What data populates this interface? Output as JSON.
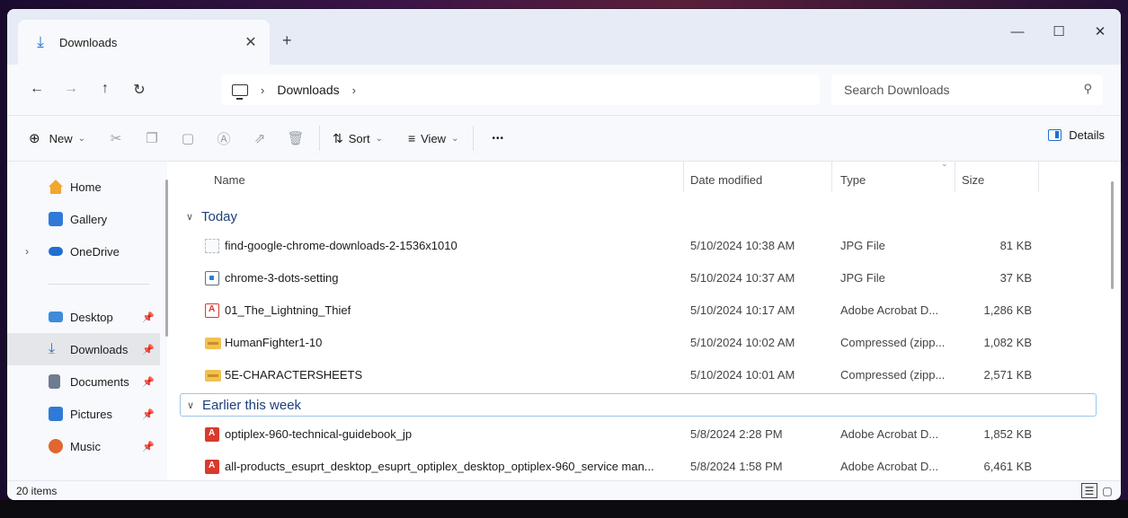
{
  "tab": {
    "title": "Downloads",
    "close": "✕",
    "new_tab": "+"
  },
  "window_controls": {
    "minimize": "—",
    "maximize": "☐",
    "close": "✕"
  },
  "nav": {
    "back": "←",
    "forward": "→",
    "up": "↑",
    "refresh": "↻"
  },
  "breadcrumb": {
    "sep1": "›",
    "current": "Downloads",
    "sep2": "›"
  },
  "search": {
    "placeholder": "Search Downloads",
    "icon": "search-icon"
  },
  "commands": {
    "new_label": "New",
    "sort_label": "Sort",
    "view_label": "View",
    "more": "•••",
    "details_label": "Details"
  },
  "sidebar": {
    "items": [
      {
        "label": "Home",
        "icon": "home-icon",
        "color": "#f0a830"
      },
      {
        "label": "Gallery",
        "icon": "gallery-icon",
        "color": "#2f7ad8"
      },
      {
        "label": "OneDrive",
        "icon": "cloud-icon",
        "color": "#1f6fd0"
      },
      {
        "label": "Desktop",
        "icon": "desktop-icon",
        "color": "#3d8bd9"
      },
      {
        "label": "Downloads",
        "icon": "download-icon",
        "color": "#1f6fd0"
      },
      {
        "label": "Documents",
        "icon": "documents-icon",
        "color": "#6f7c8f"
      },
      {
        "label": "Pictures",
        "icon": "pictures-icon",
        "color": "#2f7ad8"
      },
      {
        "label": "Music",
        "icon": "music-icon",
        "color": "#e0672f"
      }
    ]
  },
  "columns": {
    "name": "Name",
    "date": "Date modified",
    "type": "Type",
    "size": "Size"
  },
  "groups": {
    "today": "Today",
    "earlier": "Earlier this week"
  },
  "files": [
    {
      "name": "find-google-chrome-downloads-2-1536x1010",
      "date": "5/10/2024 10:38 AM",
      "type": "JPG File",
      "size": "81 KB",
      "icon": "image-placeholder-icon"
    },
    {
      "name": "chrome-3-dots-setting",
      "date": "5/10/2024 10:37 AM",
      "type": "JPG File",
      "size": "37 KB",
      "icon": "image-file-icon"
    },
    {
      "name": "01_The_Lightning_Thief",
      "date": "5/10/2024 10:17 AM",
      "type": "Adobe Acrobat D...",
      "size": "1,286 KB",
      "icon": "pdf-icon"
    },
    {
      "name": "HumanFighter1-10",
      "date": "5/10/2024 10:02 AM",
      "type": "Compressed (zipp...",
      "size": "1,082 KB",
      "icon": "zip-folder-icon"
    },
    {
      "name": "5E-CHARACTERSHEETS",
      "date": "5/10/2024 10:01 AM",
      "type": "Compressed (zipp...",
      "size": "2,571 KB",
      "icon": "zip-folder-icon"
    },
    {
      "name": "optiplex-960-technical-guidebook_jp",
      "date": "5/8/2024 2:28 PM",
      "type": "Adobe Acrobat D...",
      "size": "1,852 KB",
      "icon": "pdf-icon"
    },
    {
      "name": "all-products_esuprt_desktop_esuprt_optiplex_desktop_optiplex-960_service man...",
      "date": "5/8/2024 1:58 PM",
      "type": "Adobe Acrobat D...",
      "size": "6,461 KB",
      "icon": "pdf-icon"
    }
  ],
  "status": {
    "item_count": "20 items"
  }
}
